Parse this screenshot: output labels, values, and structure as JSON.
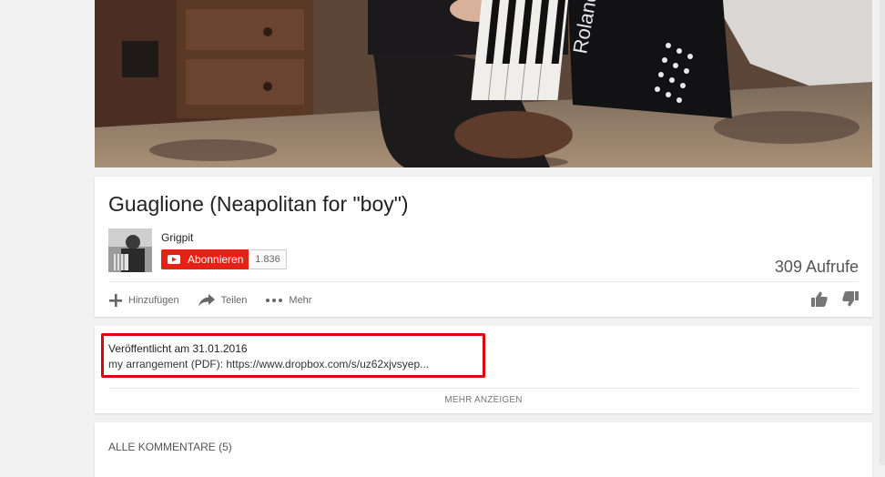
{
  "video": {
    "title": "Guaglione (Neapolitan for \"boy\")",
    "accordion_brand": "Roland"
  },
  "channel": {
    "name": "Grigpit",
    "subscribe_label": "Abonnieren",
    "subscriber_count": "1.836"
  },
  "stats": {
    "views": "309 Aufrufe"
  },
  "actions": {
    "add": "Hinzufügen",
    "share": "Teilen",
    "more": "Mehr"
  },
  "description": {
    "published": "Veröffentlicht am 31.01.2016",
    "text": "my arrangement (PDF): https://www.dropbox.com/s/uz62xjvsyep...",
    "show_more": "MEHR ANZEIGEN"
  },
  "comments": {
    "header": "ALLE KOMMENTARE (5)"
  },
  "colors": {
    "subscribe_red": "#e62117",
    "highlight_red": "#e0000e",
    "page_bg": "#f1f1f1"
  }
}
